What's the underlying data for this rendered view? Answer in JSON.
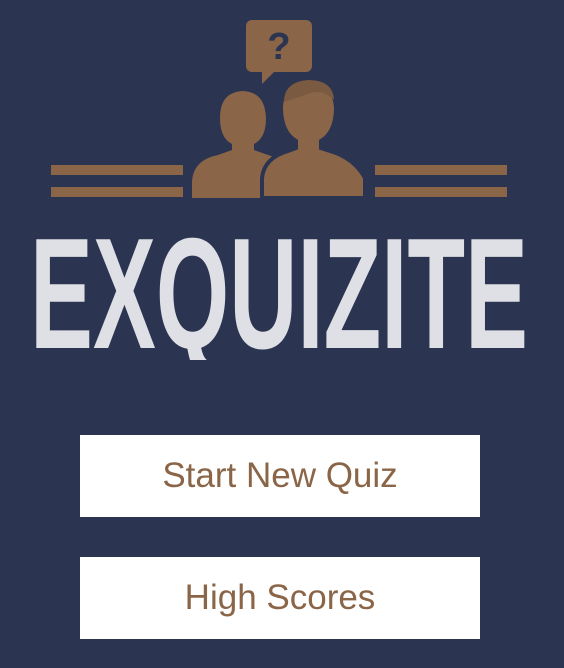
{
  "app": {
    "logo_text": "EXQUIZITE",
    "logo_icon": "two-people-question-icon",
    "question_glyph": "?"
  },
  "menu": {
    "start_label": "Start New Quiz",
    "scores_label": "High Scores"
  },
  "colors": {
    "background": "#2b3552",
    "accent": "#8a6547",
    "wordmark": "#dfe0e5",
    "button_bg": "#ffffff"
  }
}
